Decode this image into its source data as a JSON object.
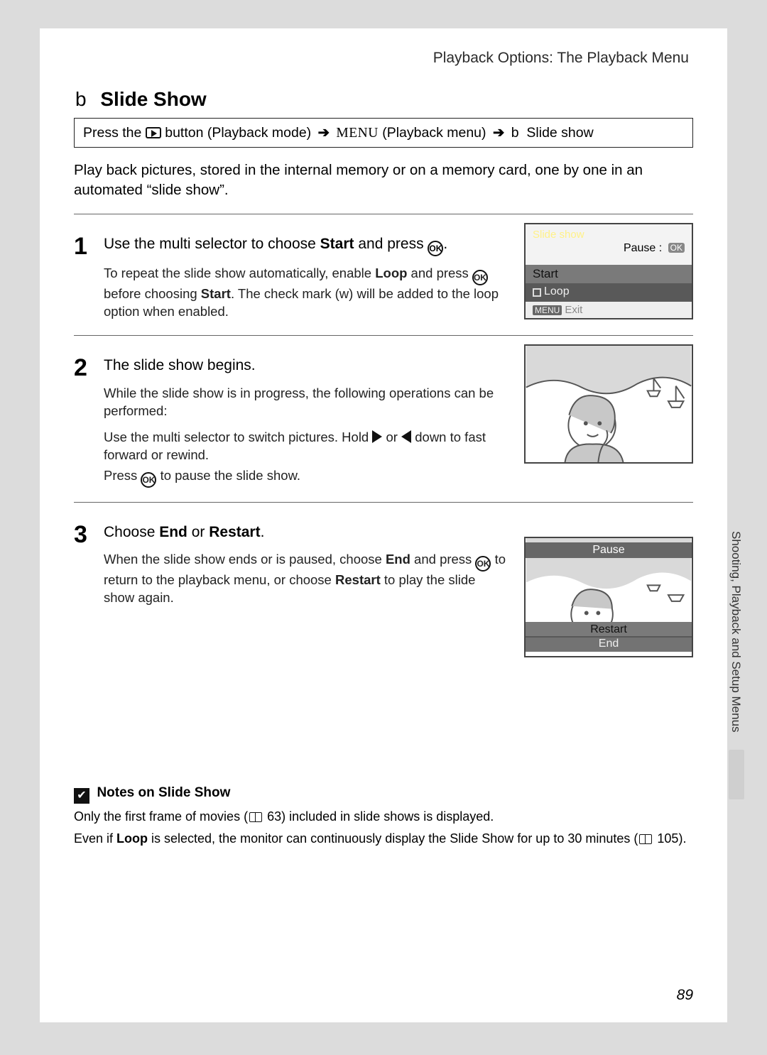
{
  "header": {
    "breadcrumb": "Playback Options: The Playback Menu"
  },
  "section": {
    "icon_letter": "b",
    "title": "Slide Show",
    "nav_path": {
      "press_the": "Press the",
      "playback_mode": "button (Playback mode)",
      "menu_word": "MENU",
      "playback_menu": "(Playback menu)",
      "final_icon": "b",
      "final_text": "Slide show"
    },
    "intro": "Play back pictures, stored in the internal memory or on a memory card, one by one in an automated “slide show”."
  },
  "steps": [
    {
      "num": "1",
      "headline_pre": "Use the multi selector to choose ",
      "headline_bold": "Start",
      "headline_post": " and press ",
      "headline_end": ".",
      "detail_1a": "To repeat the slide show automatically, enable ",
      "detail_1b": "Loop",
      "detail_1c": " and press ",
      "detail_1d": " before choosing ",
      "detail_1e": "Start",
      "detail_1f": ". The check mark (",
      "detail_1g": "w",
      "detail_1h": ") will be added to the loop option when enabled."
    },
    {
      "num": "2",
      "headline": "The slide show begins.",
      "detail_a": "While the slide show is in progress, the following operations can be performed:",
      "detail_b_pre": "Use the multi selector to switch pictures. Hold ",
      "detail_b_mid": " or ",
      "detail_b_post": " down to fast forward or rewind.",
      "detail_c_pre": "Press ",
      "detail_c_post": " to pause the slide show."
    },
    {
      "num": "3",
      "headline_pre": "Choose ",
      "headline_b1": "End",
      "headline_mid": " or ",
      "headline_b2": "Restart",
      "headline_end": ".",
      "detail_pre": "When the slide show ends or is paused, choose ",
      "detail_b1": "End",
      "detail_mid1": " and press ",
      "detail_mid2": " to return to the playback menu, or choose ",
      "detail_b2": "Restart",
      "detail_post": " to play the slide show again."
    }
  ],
  "fig1": {
    "title": "Slide show",
    "pause_label": "Pause",
    "ok_tiny": "OK",
    "start": "Start",
    "loop": "Loop",
    "exit_badge": "MENU",
    "exit": "Exit"
  },
  "fig3": {
    "pause": "Pause",
    "restart": "Restart",
    "end": "End"
  },
  "side_tab": "Shooting, Playback and Setup Menus",
  "notes": {
    "title": "Notes on Slide Show",
    "line1_pre": "Only the first frame of movies (",
    "line1_ref": "63",
    "line1_post": ") included in slide shows is displayed.",
    "line2_pre": "Even if ",
    "line2_bold": "Loop",
    "line2_mid": " is selected, the monitor can continuously display the Slide Show for up to 30 minutes (",
    "line2_ref": "105",
    "line2_post": ")."
  },
  "page_number": "89",
  "ok_label": "OK"
}
